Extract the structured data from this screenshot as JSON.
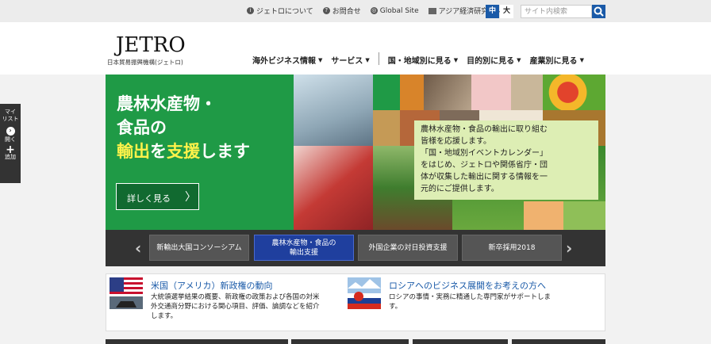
{
  "topbar": {
    "links": [
      {
        "label": "ジェトロについて",
        "icon": "info-icon"
      },
      {
        "label": "お問合せ",
        "icon": "question-icon"
      },
      {
        "label": "Global Site",
        "icon": "globe-icon"
      },
      {
        "label": "アジア経済研究所",
        "icon": "building-icon"
      }
    ],
    "text_size_mid": "中",
    "text_size_big": "大",
    "search_placeholder": "サイト内検索"
  },
  "header": {
    "logo": "JETRO",
    "logo_sub": "日本貿易振興機構(ジェトロ)",
    "nav": [
      "海外ビジネス情報",
      "サービス",
      "国・地域別に見る",
      "目的別に見る",
      "産業別に見る"
    ]
  },
  "mylist": {
    "label1": "マイ",
    "label2": "リスト",
    "open": "開く",
    "add": "追加"
  },
  "hero": {
    "title_line1": "農林水産物・",
    "title_line2": "食品の",
    "title_line3a": "輸出",
    "title_line3b": "を",
    "title_line3c": "支援",
    "title_line3d": "します",
    "button": "詳しく見る",
    "callout_lines": [
      "農林水産物・食品の輸出に取り組む",
      "皆様を応援します。",
      "「国・地域別イベントカレンダー」",
      "をはじめ、ジェトロや関係省庁・団",
      "体が収集した輸出に関する情報を一",
      "元的にご提供します。"
    ]
  },
  "slider": {
    "tabs": [
      {
        "line1": "新輸出大国コンソーシアム",
        "line2": ""
      },
      {
        "line1": "農林水産物・食品の",
        "line2": "輸出支援"
      },
      {
        "line1": "外国企業の対日投資支援",
        "line2": ""
      },
      {
        "line1": "新卒採用2018",
        "line2": ""
      }
    ]
  },
  "news": [
    {
      "title": "米国（アメリカ）新政権の動向",
      "desc": [
        "大統領選挙結果の概要、新政権の政策および各国の対米",
        "外交通商分野における関心項目、評価、論調などを紹介",
        "します。"
      ]
    },
    {
      "title": "ロシアへのビジネス展開をお考えの方へ",
      "desc": [
        "ロシアの事情・実務に精通した専門家がサポートしま",
        "す。"
      ]
    }
  ],
  "colors": {
    "brand_blue": "#1a5aa8",
    "hero_green": "#1f9a46",
    "callout_green": "#ddeeb4",
    "highlight_yellow": "#fff24a"
  }
}
